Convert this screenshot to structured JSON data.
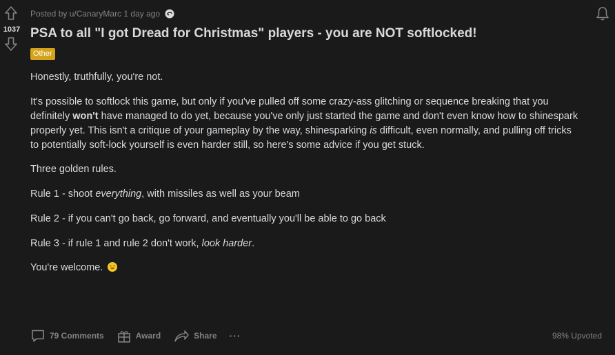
{
  "vote": {
    "score": "1037",
    "up_icon": "arrow-up-icon",
    "down_icon": "arrow-down-icon"
  },
  "meta": {
    "posted_by": "Posted by u/CanaryMarc 1 day ago"
  },
  "post": {
    "title": "PSA to all \"I got Dread for Christmas\" players - you are NOT softlocked!",
    "flair": "Other",
    "p1": "Honestly, truthfully, you're not.",
    "p2_a": "It's possible to softlock this game, but only if you've pulled off some crazy-ass glitching or sequence breaking that you definitely ",
    "p2_bold": "won't",
    "p2_b": " have managed to do yet, because you've only just started the game and don't even know how to shinespark properly yet. This isn't a critique of your gameplay by the way, shinesparking ",
    "p2_italic": "is",
    "p2_c": " difficult, even normally, and pulling off tricks to potentially soft-lock yourself is even harder still, so here's some advice if you get stuck.",
    "p3": "Three golden rules.",
    "p4_a": "Rule 1 - shoot ",
    "p4_italic": "everything",
    "p4_b": ", with missiles as well as your beam",
    "p5": "Rule 2 - if you can't go back, go forward, and eventually you'll be able to go back",
    "p6_a": "Rule 3 - if rule 1 and rule 2 don't work, ",
    "p6_italic": "look harder",
    "p6_b": ".",
    "p7": "You're welcome."
  },
  "footer": {
    "comments": "79 Comments",
    "award": "Award",
    "share": "Share",
    "more": "···",
    "upvoted": "98% Upvoted"
  }
}
